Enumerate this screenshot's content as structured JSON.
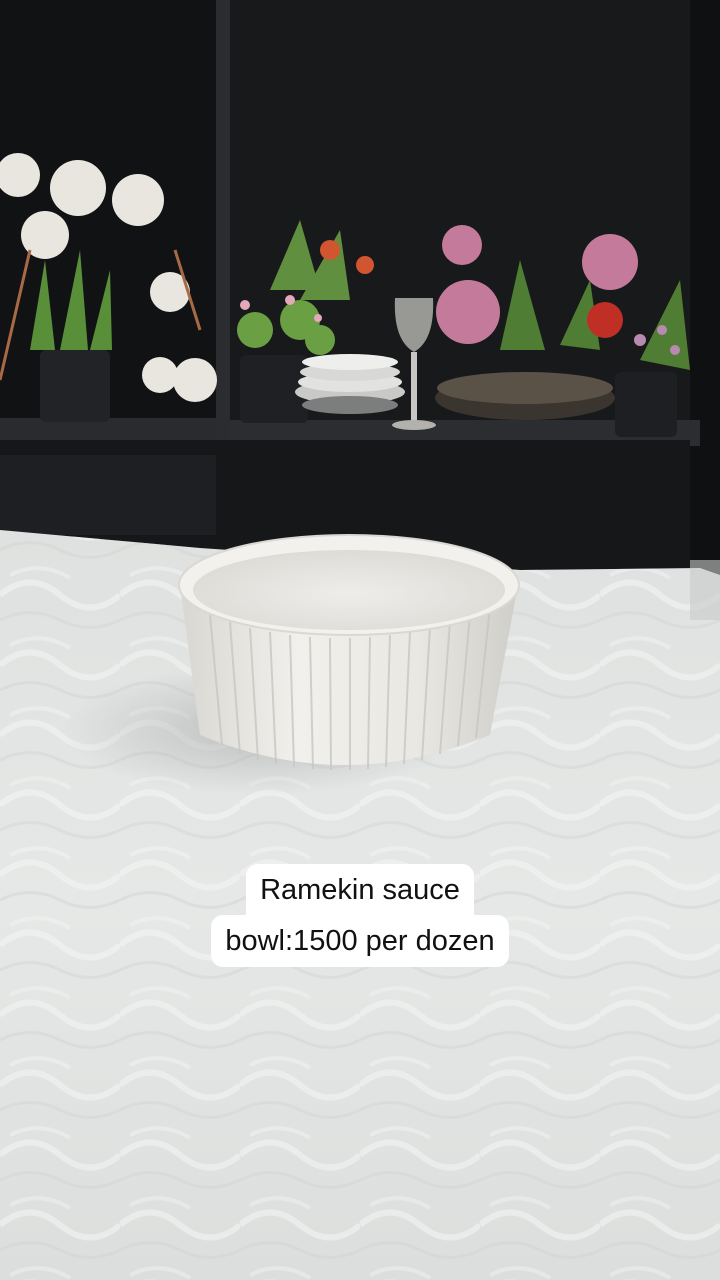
{
  "caption": {
    "line1": "Ramekin sauce",
    "line2": "bowl:1500 per dozen"
  },
  "colors": {
    "shelf": "#1b1c1e",
    "tablecloth": "#e4e6e5",
    "bowl": "#ecebe6",
    "caption_background": "#ffffff",
    "caption_text": "#111111"
  },
  "scene": {
    "objects": [
      "ramekin-bowl",
      "white-tablecloth",
      "dark-shelf",
      "potted-artificial-flowers",
      "wine-glass",
      "stacked-plates",
      "serving-tray"
    ]
  }
}
